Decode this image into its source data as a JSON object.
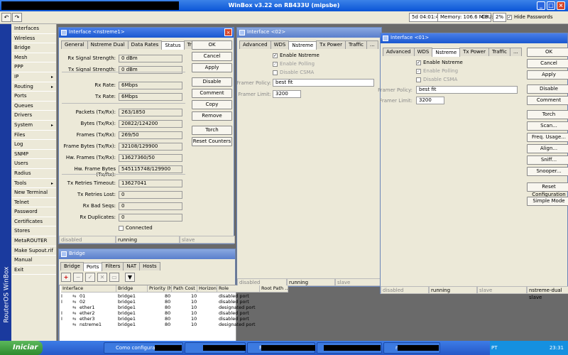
{
  "window": {
    "title": "WinBox v3.22 on RB433U (mipsbe)"
  },
  "toolbar": {
    "uptime": "5d 04:01:49",
    "memory": "Memory: 106.6 MiB",
    "cpu_label": "CPU:",
    "cpu": "2%",
    "hide_passwords": "Hide Passwords"
  },
  "sidebar": {
    "brand": "RouterOS WinBox",
    "items": [
      "Interfaces",
      "Wireless",
      "Bridge",
      "Mesh",
      "PPP",
      "IP",
      "Routing",
      "Ports",
      "Queues",
      "Drivers",
      "System",
      "Files",
      "Log",
      "SNMP",
      "Users",
      "Radius",
      "Tools",
      "New Terminal",
      "Telnet",
      "Password",
      "Certificates",
      "Stores",
      "MetaROUTER",
      "Make Supout.rif",
      "Manual",
      "Exit"
    ]
  },
  "iface1": {
    "title": "Interface <nstreme1>",
    "tabs": [
      "General",
      "Nstreme Dual",
      "Data Rates",
      "Status",
      "Traffic"
    ],
    "rows": [
      {
        "label": "Rx Signal Strength:",
        "value": "0 dBm"
      },
      {
        "label": "Tx Signal Strength:",
        "value": "0 dBm"
      },
      {
        "label": "Rx Rate:",
        "value": "6Mbps"
      },
      {
        "label": "Tx Rate:",
        "value": "6Mbps"
      },
      {
        "label": "Packets (Tx/Rx):",
        "value": "263/1850"
      },
      {
        "label": "Bytes (Tx/Rx):",
        "value": "20822/124200"
      },
      {
        "label": "Frames (Tx/Rx):",
        "value": "269/50"
      },
      {
        "label": "Frame Bytes (Tx/Rx):",
        "value": "32108/129900"
      },
      {
        "label": "Hw. Frames (Tx/Rx):",
        "value": "13627360/50"
      },
      {
        "label": "Hw. Frame Bytes (Tx/Rx):",
        "value": "545115748/129900"
      },
      {
        "label": "Tx Retries Timeout:",
        "value": "13627041"
      },
      {
        "label": "Tx Retries Lost:",
        "value": "0"
      },
      {
        "label": "Rx Bad Seqs:",
        "value": "0"
      },
      {
        "label": "Rx Duplicates:",
        "value": "0"
      }
    ],
    "connected": "Connected",
    "buttons": [
      "OK",
      "Cancel",
      "Apply",
      "Disable",
      "Comment",
      "Copy",
      "Remove",
      "Torch",
      "Reset Counters"
    ],
    "status": [
      "disabled",
      "running",
      "slave"
    ]
  },
  "iface2": {
    "title": "Interface <02>",
    "tabs": [
      "Advanced",
      "WDS",
      "Nstreme",
      "Tx Power",
      "Traffic",
      "..."
    ],
    "enable": "Enable Nstreme",
    "polling": "Enable Polling",
    "csma": "Disable CSMA",
    "policy_label": "Framer Policy:",
    "policy": "best fit",
    "limit_label": "Framer Limit:",
    "limit": "3200",
    "status": [
      "disabled",
      "running",
      "slave"
    ]
  },
  "iface3": {
    "title": "Interface <01>",
    "tabs": [
      "Advanced",
      "WDS",
      "Nstreme",
      "Tx Power",
      "Traffic",
      "..."
    ],
    "enable": "Enable Nstreme",
    "polling": "Enable Polling",
    "csma": "Disable CSMA",
    "policy_label": "Framer Policy:",
    "policy": "best fit",
    "limit_label": "Framer Limit:",
    "limit": "3200",
    "buttons": [
      "OK",
      "Cancel",
      "Apply",
      "Disable",
      "Comment",
      "Torch",
      "Scan...",
      "Freq. Usage...",
      "Align...",
      "Sniff...",
      "Snooper...",
      "Reset Configuration",
      "Simple Mode"
    ],
    "status": [
      "disabled",
      "running",
      "slave",
      "nstreme-dual slave"
    ]
  },
  "bridge": {
    "title": "Bridge",
    "tabs": [
      "Bridge",
      "Ports",
      "Filters",
      "NAT",
      "Hosts"
    ],
    "columns": [
      "Interface",
      "Bridge",
      "Priority (h...",
      "Path Cost",
      "Horizon",
      "Role",
      "Root Path ..."
    ],
    "rows": [
      {
        "flag": "I",
        "iface": "01",
        "bridge": "bridge1",
        "prio": "80",
        "cost": "10",
        "horizon": "",
        "role": "disabled port"
      },
      {
        "flag": "I",
        "iface": "02",
        "bridge": "bridge1",
        "prio": "80",
        "cost": "10",
        "horizon": "",
        "role": "disabled port"
      },
      {
        "flag": "",
        "iface": "ether1",
        "bridge": "bridge1",
        "prio": "80",
        "cost": "10",
        "horizon": "",
        "role": "designated port"
      },
      {
        "flag": "I",
        "iface": "ether2",
        "bridge": "bridge1",
        "prio": "80",
        "cost": "10",
        "horizon": "",
        "role": "disabled port"
      },
      {
        "flag": "I",
        "iface": "ether3",
        "bridge": "bridge1",
        "prio": "80",
        "cost": "10",
        "horizon": "",
        "role": "disabled port"
      },
      {
        "flag": "",
        "iface": "nstreme1",
        "bridge": "bridge1",
        "prio": "80",
        "cost": "10",
        "horizon": "",
        "role": "designated port"
      }
    ]
  },
  "taskbar": {
    "start": "Iniciar",
    "tasks": [
      "Como configurar NST...",
      "",
      "Prompt de comando",
      "",
      "mk 0010 - Paint"
    ],
    "lang": "PT",
    "clock": "23:31"
  }
}
